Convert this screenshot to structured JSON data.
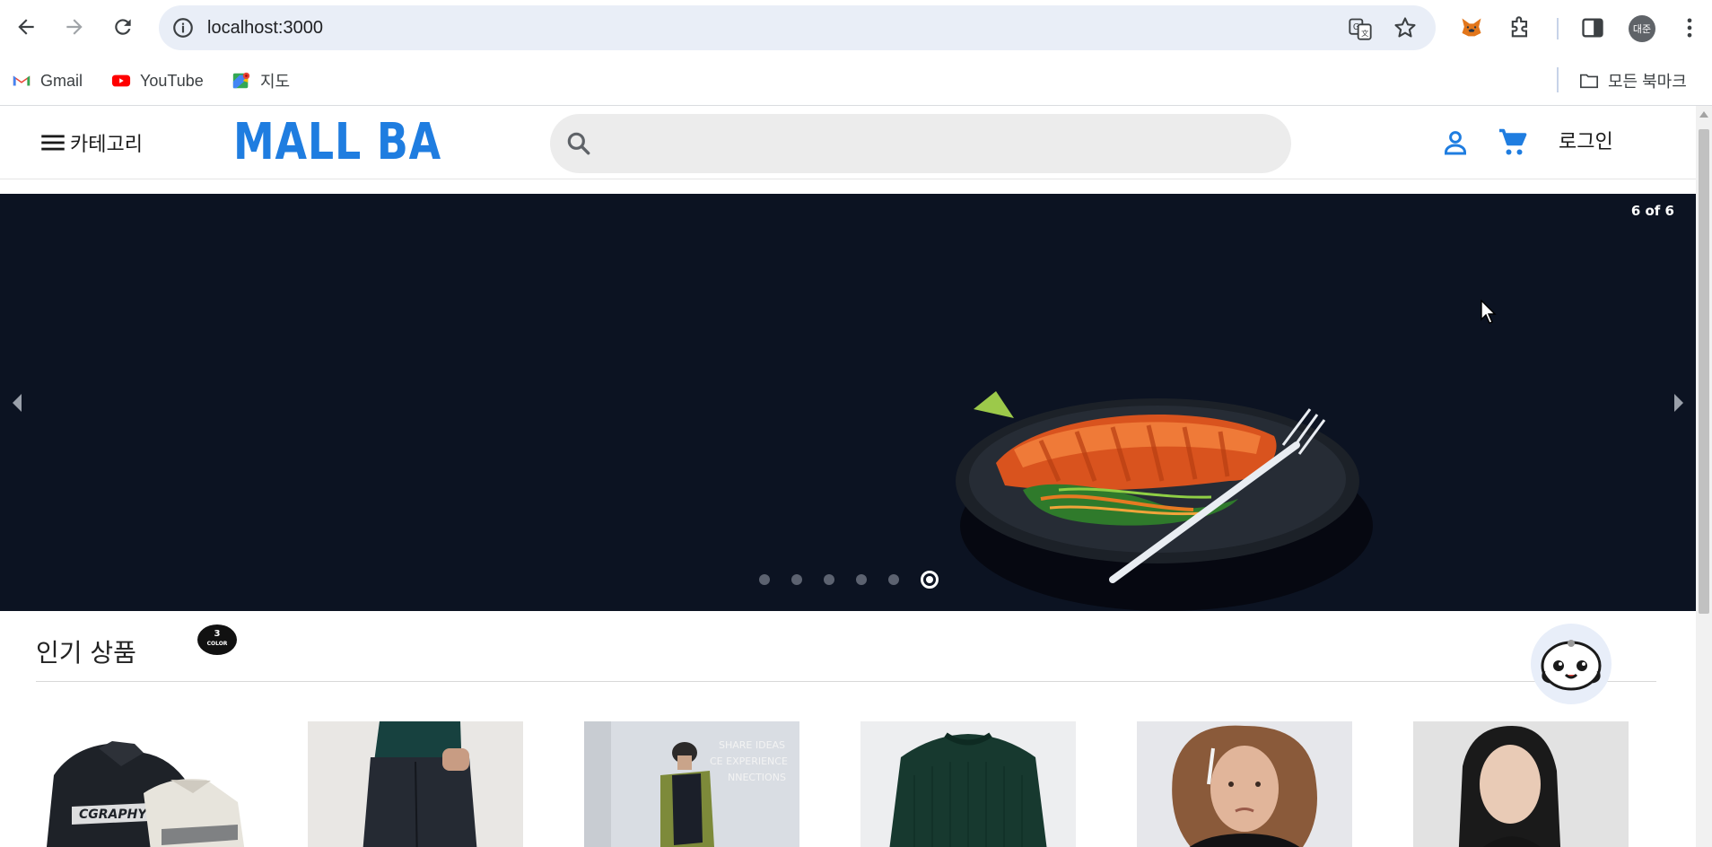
{
  "browser": {
    "url": "localhost:3000",
    "profile_initials": "대준",
    "bookmarks": [
      {
        "label": "Gmail",
        "icon": "gmail-icon"
      },
      {
        "label": "YouTube",
        "icon": "youtube-icon"
      },
      {
        "label": "지도",
        "icon": "maps-icon"
      }
    ],
    "all_bookmarks_label": "모든 북마크"
  },
  "header": {
    "category_label": "카테고리",
    "logo_text": "MALL BA",
    "search_placeholder": "",
    "login_label": "로그인",
    "brand_color": "#1f7de0"
  },
  "carousel": {
    "counter": "6 of 6",
    "current_slide": 6,
    "total_slides": 6,
    "background_color": "#0c1322"
  },
  "popular": {
    "title": "인기 상품",
    "badge_number": "3",
    "badge_text": "COLOR",
    "products": [
      {
        "name": "product-jacket"
      },
      {
        "name": "product-jeans"
      },
      {
        "name": "product-vest"
      },
      {
        "name": "product-sweater"
      },
      {
        "name": "product-graphic-tee"
      },
      {
        "name": "product-black-tee"
      }
    ]
  }
}
